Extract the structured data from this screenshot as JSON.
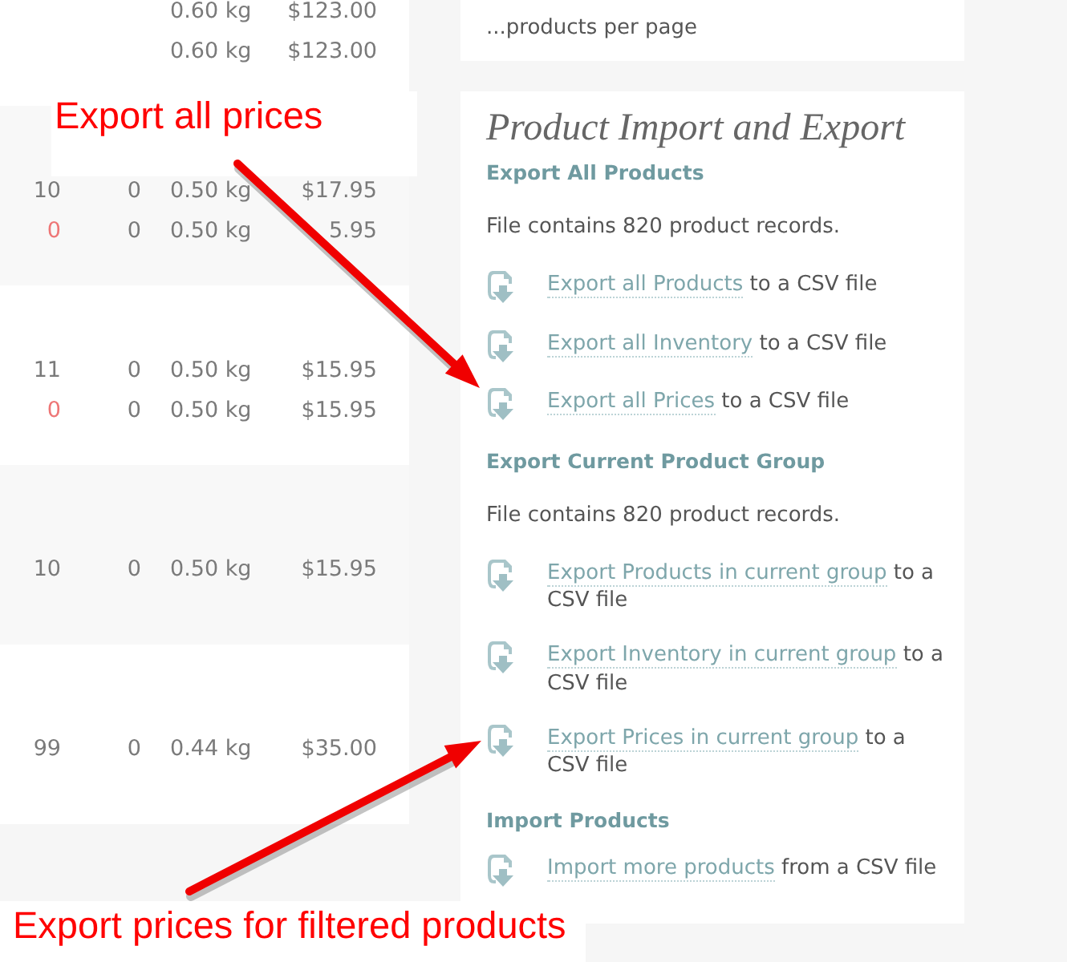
{
  "product_table": {
    "groups": [
      {
        "rows": [
          {
            "column_3": "0.60 kg",
            "column_4": "$123.00"
          },
          {
            "column_3": "0.60 kg",
            "column_4": "$123.00"
          }
        ]
      },
      {
        "rows": [
          {
            "column_1": "10",
            "alert": false,
            "column_2": "0",
            "column_3": "0.50 kg",
            "column_4": "$17.95"
          },
          {
            "column_1": "0",
            "alert": true,
            "column_2": "0",
            "column_3": "0.50 kg",
            "column_4": "5.95"
          }
        ]
      },
      {
        "rows": [
          {
            "column_1": "11",
            "alert": false,
            "column_2": "0",
            "column_3": "0.50 kg",
            "column_4": "$15.95"
          },
          {
            "column_1": "0",
            "alert": true,
            "column_2": "0",
            "column_3": "0.50 kg",
            "column_4": "$15.95"
          }
        ]
      },
      {
        "rows": [
          {
            "column_1": "10",
            "alert": false,
            "column_2": "0",
            "column_3": "0.50 kg",
            "column_4": "$15.95"
          }
        ]
      },
      {
        "rows": [
          {
            "column_1": "99",
            "alert": false,
            "column_2": "0",
            "column_3": "0.44 kg",
            "column_4": "$35.00"
          }
        ]
      }
    ]
  },
  "page_size_card": {
    "text": "...products per page"
  },
  "import_export": {
    "title": "Product Import and Export",
    "sections": [
      {
        "heading": "Export All Products",
        "note": "File contains 820 product records.",
        "actions": [
          {
            "link": "Export all Products",
            "text": "to a CSV file"
          },
          {
            "link": "Export all Inventory",
            "text": "to a CSV file"
          },
          {
            "link": "Export all Prices",
            "text": "to a CSV file"
          }
        ]
      },
      {
        "heading": "Export Current Product Group",
        "note": "File contains 820 product records.",
        "actions": [
          {
            "link": "Export Products in current group",
            "text": "to a CSV file"
          },
          {
            "link": "Export Inventory in current group",
            "text": "to a CSV file"
          },
          {
            "link": "Export Prices in current group",
            "text": "to a CSV file"
          }
        ]
      },
      {
        "heading": "Import Products",
        "actions": [
          {
            "link": "Import more products",
            "text": "from a CSV file"
          }
        ]
      }
    ]
  },
  "annotations": [
    {
      "text": "Export all prices"
    },
    {
      "text": "Export prices for filtered products"
    }
  ]
}
